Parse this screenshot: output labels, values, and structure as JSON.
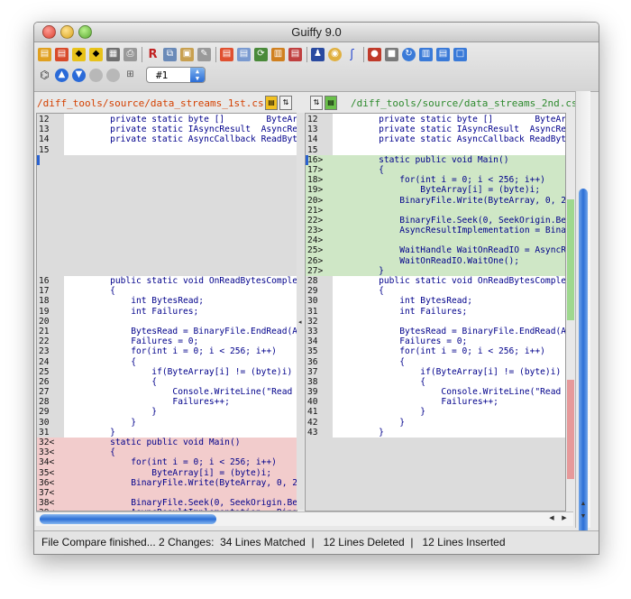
{
  "window": {
    "title": "Guiffy 9.0"
  },
  "toolbar": {
    "file_combo_value": "#1"
  },
  "left": {
    "path": "/diff_tools/source/data_streams_1st.cs",
    "lines": [
      {
        "n": "12",
        "c": "    private static byte []        ByteArr",
        "t": ""
      },
      {
        "n": "13",
        "c": "    private static IAsyncResult  AsyncRe",
        "t": ""
      },
      {
        "n": "14",
        "c": "    private static AsyncCallback ReadByt",
        "t": ""
      },
      {
        "n": "15",
        "c": "",
        "t": ""
      },
      {
        "n": "",
        "c": "",
        "t": "gap",
        "mk": true
      },
      {
        "n": "",
        "c": "",
        "t": "gap"
      },
      {
        "n": "",
        "c": "",
        "t": "gap"
      },
      {
        "n": "",
        "c": "",
        "t": "gap"
      },
      {
        "n": "",
        "c": "",
        "t": "gap"
      },
      {
        "n": "",
        "c": "",
        "t": "gap"
      },
      {
        "n": "",
        "c": "",
        "t": "gap"
      },
      {
        "n": "",
        "c": "",
        "t": "gap"
      },
      {
        "n": "",
        "c": "",
        "t": "gap"
      },
      {
        "n": "",
        "c": "",
        "t": "gap"
      },
      {
        "n": "",
        "c": "",
        "t": "gap"
      },
      {
        "n": "",
        "c": "",
        "t": "gap"
      },
      {
        "n": "16",
        "c": "    public static void OnReadBytesComple",
        "t": ""
      },
      {
        "n": "17",
        "c": "    {",
        "t": ""
      },
      {
        "n": "18",
        "c": "        int BytesRead;",
        "t": ""
      },
      {
        "n": "19",
        "c": "        int Failures;",
        "t": ""
      },
      {
        "n": "20",
        "c": "",
        "t": ""
      },
      {
        "n": "21",
        "c": "        BytesRead = BinaryFile.EndRead(A",
        "t": ""
      },
      {
        "n": "22",
        "c": "        Failures = 0;",
        "t": ""
      },
      {
        "n": "23",
        "c": "        for(int i = 0; i < 256; i++)",
        "t": ""
      },
      {
        "n": "24",
        "c": "        {",
        "t": ""
      },
      {
        "n": "25",
        "c": "            if(ByteArray[i] != (byte)i)",
        "t": ""
      },
      {
        "n": "26",
        "c": "            {",
        "t": ""
      },
      {
        "n": "27",
        "c": "                Console.WriteLine(\"Read",
        "t": ""
      },
      {
        "n": "28",
        "c": "                Failures++;",
        "t": ""
      },
      {
        "n": "29",
        "c": "            }",
        "t": ""
      },
      {
        "n": "30",
        "c": "        }",
        "t": ""
      },
      {
        "n": "31",
        "c": "    }",
        "t": ""
      },
      {
        "n": "32<",
        "c": "    static public void Main()",
        "t": "del"
      },
      {
        "n": "33<",
        "c": "    {",
        "t": "del"
      },
      {
        "n": "34<",
        "c": "        for(int i = 0; i < 256; i++)",
        "t": "del"
      },
      {
        "n": "35<",
        "c": "            ByteArray[i] = (byte)i;",
        "t": "del"
      },
      {
        "n": "36<",
        "c": "        BinaryFile.Write(ByteArray, 0, 2",
        "t": "del"
      },
      {
        "n": "37<",
        "c": "",
        "t": "del"
      },
      {
        "n": "38<",
        "c": "        BinaryFile.Seek(0, SeekOrigin.Be",
        "t": "del"
      },
      {
        "n": "39<",
        "c": "        AsyncResultImplementation = Bina",
        "t": "del"
      }
    ]
  },
  "right": {
    "path": "/diff_tools/source/data_streams_2nd.cs",
    "lines": [
      {
        "n": "12",
        "c": "    private static byte []        ByteArr",
        "t": ""
      },
      {
        "n": "13",
        "c": "    private static IAsyncResult  AsyncRe",
        "t": ""
      },
      {
        "n": "14",
        "c": "    private static AsyncCallback ReadByt",
        "t": ""
      },
      {
        "n": "15",
        "c": "",
        "t": ""
      },
      {
        "n": "16>",
        "c": "    static public void Main()",
        "t": "add",
        "mk": true
      },
      {
        "n": "17>",
        "c": "    {",
        "t": "add"
      },
      {
        "n": "18>",
        "c": "        for(int i = 0; i < 256; i++)",
        "t": "add"
      },
      {
        "n": "19>",
        "c": "            ByteArray[i] = (byte)i;",
        "t": "add"
      },
      {
        "n": "20>",
        "c": "        BinaryFile.Write(ByteArray, 0, 2",
        "t": "add"
      },
      {
        "n": "21>",
        "c": "",
        "t": "add"
      },
      {
        "n": "22>",
        "c": "        BinaryFile.Seek(0, SeekOrigin.Be",
        "t": "add"
      },
      {
        "n": "23>",
        "c": "        AsyncResultImplementation = Bina",
        "t": "add"
      },
      {
        "n": "24>",
        "c": "",
        "t": "add"
      },
      {
        "n": "25>",
        "c": "        WaitHandle WaitOnReadIO = AsyncR",
        "t": "add"
      },
      {
        "n": "26>",
        "c": "        WaitOnReadIO.WaitOne();",
        "t": "add"
      },
      {
        "n": "27>",
        "c": "    }",
        "t": "add"
      },
      {
        "n": "28",
        "c": "    public static void OnReadBytesComple",
        "t": ""
      },
      {
        "n": "29",
        "c": "    {",
        "t": ""
      },
      {
        "n": "30",
        "c": "        int BytesRead;",
        "t": ""
      },
      {
        "n": "31",
        "c": "        int Failures;",
        "t": ""
      },
      {
        "n": "32",
        "c": "",
        "t": ""
      },
      {
        "n": "33",
        "c": "        BytesRead = BinaryFile.EndRead(A",
        "t": ""
      },
      {
        "n": "34",
        "c": "        Failures = 0;",
        "t": ""
      },
      {
        "n": "35",
        "c": "        for(int i = 0; i < 256; i++)",
        "t": ""
      },
      {
        "n": "36",
        "c": "        {",
        "t": ""
      },
      {
        "n": "37",
        "c": "            if(ByteArray[i] != (byte)i)",
        "t": ""
      },
      {
        "n": "38",
        "c": "            {",
        "t": ""
      },
      {
        "n": "39",
        "c": "                Console.WriteLine(\"Read",
        "t": ""
      },
      {
        "n": "40",
        "c": "                Failures++;",
        "t": ""
      },
      {
        "n": "41",
        "c": "            }",
        "t": ""
      },
      {
        "n": "42",
        "c": "        }",
        "t": ""
      },
      {
        "n": "43",
        "c": "    }",
        "t": ""
      },
      {
        "n": "",
        "c": "",
        "t": "gap"
      },
      {
        "n": "",
        "c": "",
        "t": "gap"
      },
      {
        "n": "",
        "c": "",
        "t": "gap"
      },
      {
        "n": "",
        "c": "",
        "t": "gap"
      },
      {
        "n": "",
        "c": "",
        "t": "gap"
      },
      {
        "n": "",
        "c": "",
        "t": "gap"
      },
      {
        "n": "",
        "c": "",
        "t": "gap"
      },
      {
        "n": "",
        "c": "",
        "t": "gap"
      }
    ]
  },
  "colors": {
    "added": "#cfe7c6",
    "deleted": "#f2cccc",
    "gap": "#dcdcdc",
    "code": "#00008b",
    "keyword": "#0000cc",
    "string": "#cc4400",
    "left_path": "#d44000",
    "right_path": "#2d8a2d"
  },
  "status": {
    "message": "File Compare finished... 2 Changes:  34 Lines Matched  |   12 Lines Deleted  |   12 Lines Inserted"
  }
}
